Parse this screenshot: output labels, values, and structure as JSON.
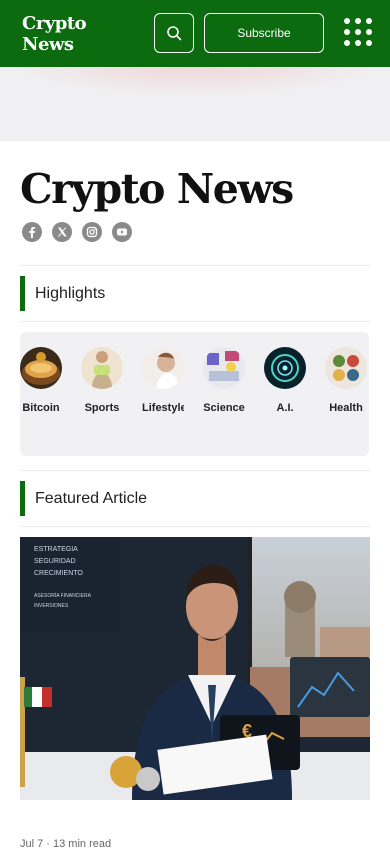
{
  "header": {
    "brand_line1": "Crypto",
    "brand_line2": "News",
    "subscribe_label": "Subscribe",
    "accent": "#0c6b0e"
  },
  "site": {
    "title": "Crypto News",
    "socials": [
      "facebook-icon",
      "x-icon",
      "instagram-icon",
      "youtube-icon"
    ]
  },
  "highlights": {
    "heading": "Highlights",
    "categories": [
      {
        "label": "Bitcoin",
        "icon": "bitcoin-bowl-image"
      },
      {
        "label": "Sports",
        "icon": "sports-image"
      },
      {
        "label": "Lifestyle",
        "icon": "lifestyle-image"
      },
      {
        "label": "Science",
        "icon": "science-image"
      },
      {
        "label": "A.I.",
        "icon": "ai-image"
      },
      {
        "label": "Health",
        "icon": "health-image"
      }
    ]
  },
  "featured": {
    "heading": "Featured Article",
    "image_sign_lines": [
      "ESTRATEGIA",
      "SEGURIDAD",
      "CRECIMIENTO",
      "ASESORÍA FINANCIERA",
      "INVERSIONES"
    ],
    "meta": "Jul 7  ·  13 min read"
  }
}
